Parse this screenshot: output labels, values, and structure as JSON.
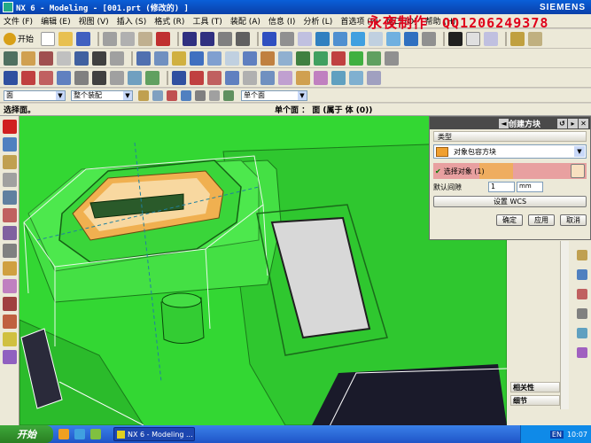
{
  "window": {
    "title": "NX 6 - Modeling - [001.prt  (修改的) ]",
    "brand": "SIEMENS"
  },
  "menu": [
    "文件 (F)",
    "编辑 (E)",
    "视图 (V)",
    "插入 (S)",
    "格式 (R)",
    "工具 (T)",
    "装配 (A)",
    "信息 (I)",
    "分析 (L)",
    "首选项 (P)",
    "窗口 (O)",
    "帮助 (H)"
  ],
  "watermark": {
    "text": "永夜制作",
    "qq": "QQ1206249378"
  },
  "toolbar": {
    "start_label": "开始"
  },
  "selection": {
    "filter": "面",
    "scope": "整个装配",
    "face_filter": "单个面"
  },
  "status": {
    "prompt": "选择面。",
    "info": "单个面 ： 面 (属于 体 (0))"
  },
  "dialog": {
    "title": "创建方块",
    "type_header": "类型",
    "type_value": "对象包容方块",
    "select_label": "选择对象 (1)",
    "gap_label": "默认间隙",
    "gap_value": "1",
    "gap_unit": "mm",
    "wcs_button": "设置 WCS",
    "ok": "确定",
    "apply": "应用",
    "cancel": "取消"
  },
  "panel": {
    "relevance": "相关性",
    "detail": "细节"
  },
  "taskbar": {
    "start": "开始",
    "task": "NX 6 - Modeling ...",
    "lang": "EN",
    "time": "10:07"
  },
  "colors": {
    "graphics_bg": "#33d733",
    "titlebar": "#0a3fa8",
    "accent_red": "#e0001a"
  }
}
